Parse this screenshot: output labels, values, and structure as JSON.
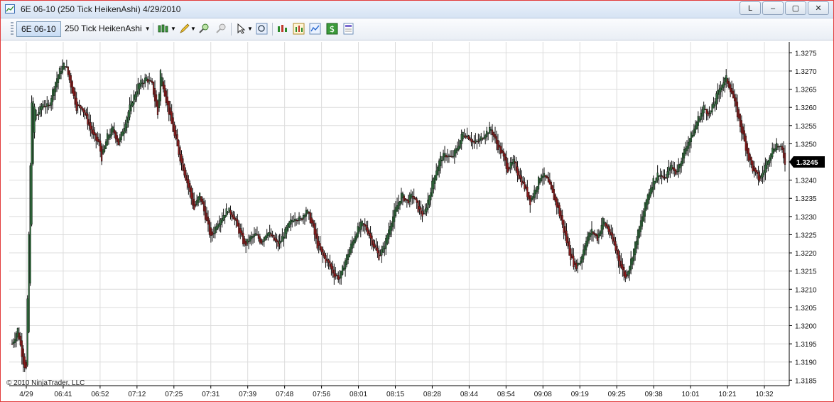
{
  "window": {
    "title": "6E 06-10 (250 Tick HeikenAshi)  4/29/2010",
    "buttons": [
      "L",
      "–",
      "▢",
      "✕"
    ]
  },
  "toolbar": {
    "instrument": "6E 06-10",
    "interval": "250 Tick HeikenAshi",
    "icons": [
      "bar-type-icon",
      "drawing-tool-icon",
      "zoom-in-icon",
      "zoom-out-icon",
      "cursor-icon",
      "magnifier-icon",
      "indicators-icon",
      "strategies-icon",
      "chart-style-icon",
      "dollar-icon",
      "properties-icon"
    ]
  },
  "copyright": "© 2010 NinjaTrader, LLC",
  "chart_data": {
    "type": "candlestick",
    "x_ticks": [
      "4/29",
      "06:41",
      "06:52",
      "07:12",
      "07:25",
      "07:31",
      "07:39",
      "07:48",
      "07:56",
      "08:01",
      "08:15",
      "08:28",
      "08:44",
      "08:54",
      "09:08",
      "09:19",
      "09:25",
      "09:38",
      "10:01",
      "10:21",
      "10:32"
    ],
    "y_ticks": [
      "1.3275",
      "1.3270",
      "1.3265",
      "1.3260",
      "1.3255",
      "1.3250",
      "1.3245",
      "1.3240",
      "1.3235",
      "1.3230",
      "1.3225",
      "1.3220",
      "1.3215",
      "1.3210",
      "1.3205",
      "1.3200",
      "1.3195",
      "1.3190",
      "1.3185"
    ],
    "ylim": [
      1.31835,
      1.3278
    ],
    "last_price": "1.3245",
    "grid": true,
    "colors": {
      "up": "#2f6b3b",
      "down": "#8b1a1a",
      "wick": "#111111",
      "grid": "#dcdcdc",
      "price_marker": "#000000"
    },
    "close_path": [
      [
        0,
        1.3195
      ],
      [
        4,
        1.3199
      ],
      [
        8,
        1.319
      ],
      [
        10,
        1.3188
      ],
      [
        12,
        1.3225
      ],
      [
        14,
        1.3262
      ],
      [
        18,
        1.3258
      ],
      [
        22,
        1.3261
      ],
      [
        26,
        1.326
      ],
      [
        30,
        1.3266
      ],
      [
        34,
        1.327
      ],
      [
        38,
        1.3272
      ],
      [
        42,
        1.3266
      ],
      [
        46,
        1.326
      ],
      [
        50,
        1.326
      ],
      [
        54,
        1.3256
      ],
      [
        58,
        1.3252
      ],
      [
        62,
        1.325
      ],
      [
        64,
        1.3246
      ],
      [
        68,
        1.3252
      ],
      [
        72,
        1.3254
      ],
      [
        76,
        1.325
      ],
      [
        80,
        1.3255
      ],
      [
        84,
        1.326
      ],
      [
        90,
        1.3266
      ],
      [
        96,
        1.3268
      ],
      [
        100,
        1.3266
      ],
      [
        104,
        1.3258
      ],
      [
        106,
        1.327
      ],
      [
        110,
        1.3262
      ],
      [
        116,
        1.3252
      ],
      [
        120,
        1.3246
      ],
      [
        126,
        1.3238
      ],
      [
        130,
        1.3232
      ],
      [
        134,
        1.3236
      ],
      [
        138,
        1.323
      ],
      [
        142,
        1.3224
      ],
      [
        146,
        1.3228
      ],
      [
        150,
        1.323
      ],
      [
        154,
        1.3232
      ],
      [
        158,
        1.323
      ],
      [
        162,
        1.3226
      ],
      [
        166,
        1.3222
      ],
      [
        170,
        1.3224
      ],
      [
        174,
        1.3225
      ],
      [
        178,
        1.3223
      ],
      [
        182,
        1.3226
      ],
      [
        186,
        1.3224
      ],
      [
        190,
        1.3222
      ],
      [
        194,
        1.3225
      ],
      [
        198,
        1.3228
      ],
      [
        202,
        1.323
      ],
      [
        206,
        1.3229
      ],
      [
        210,
        1.3232
      ],
      [
        214,
        1.3228
      ],
      [
        218,
        1.3222
      ],
      [
        222,
        1.3219
      ],
      [
        226,
        1.3217
      ],
      [
        230,
        1.3214
      ],
      [
        234,
        1.3213
      ],
      [
        238,
        1.3218
      ],
      [
        242,
        1.3222
      ],
      [
        246,
        1.3226
      ],
      [
        250,
        1.3228
      ],
      [
        254,
        1.3226
      ],
      [
        258,
        1.3222
      ],
      [
        262,
        1.3219
      ],
      [
        266,
        1.3222
      ],
      [
        270,
        1.3228
      ],
      [
        274,
        1.3232
      ],
      [
        278,
        1.3236
      ],
      [
        282,
        1.3234
      ],
      [
        286,
        1.3236
      ],
      [
        290,
        1.3232
      ],
      [
        294,
        1.323
      ],
      [
        298,
        1.3236
      ],
      [
        302,
        1.3242
      ],
      [
        306,
        1.3246
      ],
      [
        310,
        1.3247
      ],
      [
        314,
        1.3246
      ],
      [
        318,
        1.3249
      ],
      [
        322,
        1.3253
      ],
      [
        326,
        1.3252
      ],
      [
        330,
        1.325
      ],
      [
        334,
        1.3251
      ],
      [
        338,
        1.3253
      ],
      [
        342,
        1.3254
      ],
      [
        346,
        1.325
      ],
      [
        350,
        1.3247
      ],
      [
        354,
        1.3243
      ],
      [
        358,
        1.3245
      ],
      [
        362,
        1.3241
      ],
      [
        366,
        1.3238
      ],
      [
        370,
        1.3234
      ],
      [
        374,
        1.3238
      ],
      [
        378,
        1.3242
      ],
      [
        382,
        1.324
      ],
      [
        386,
        1.3236
      ],
      [
        390,
        1.3232
      ],
      [
        394,
        1.3226
      ],
      [
        398,
        1.322
      ],
      [
        402,
        1.3216
      ],
      [
        406,
        1.3218
      ],
      [
        410,
        1.3224
      ],
      [
        414,
        1.3226
      ],
      [
        418,
        1.3224
      ],
      [
        422,
        1.3229
      ],
      [
        426,
        1.3226
      ],
      [
        430,
        1.3222
      ],
      [
        434,
        1.3217
      ],
      [
        438,
        1.3213
      ],
      [
        442,
        1.3218
      ],
      [
        446,
        1.3224
      ],
      [
        450,
        1.323
      ],
      [
        454,
        1.3236
      ],
      [
        458,
        1.324
      ],
      [
        462,
        1.3242
      ],
      [
        466,
        1.324
      ],
      [
        470,
        1.3244
      ],
      [
        474,
        1.3242
      ],
      [
        478,
        1.3246
      ],
      [
        482,
        1.325
      ],
      [
        486,
        1.3253
      ],
      [
        490,
        1.3257
      ],
      [
        494,
        1.326
      ],
      [
        498,
        1.3258
      ],
      [
        502,
        1.3262
      ],
      [
        506,
        1.3266
      ],
      [
        510,
        1.3268
      ],
      [
        514,
        1.3264
      ],
      [
        518,
        1.3258
      ],
      [
        522,
        1.3252
      ],
      [
        526,
        1.3246
      ],
      [
        530,
        1.3242
      ],
      [
        534,
        1.324
      ],
      [
        538,
        1.3244
      ],
      [
        542,
        1.3248
      ],
      [
        546,
        1.325
      ],
      [
        550,
        1.3248
      ],
      [
        552,
        1.3245
      ]
    ]
  }
}
